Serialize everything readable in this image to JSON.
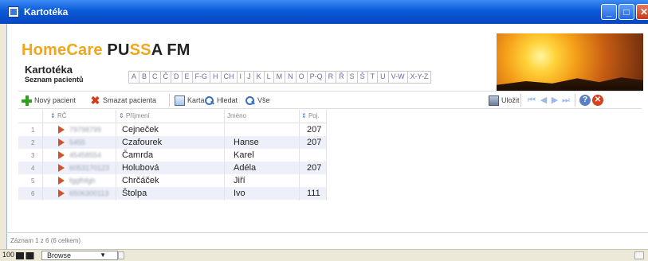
{
  "window": {
    "title": "Kartotéka"
  },
  "header": {
    "brand_part1": "HomeCare ",
    "brand_part2": "PU",
    "brand_part3": "SS",
    "brand_part4": "A FM",
    "section_title": "Kartotéka",
    "section_subtitle": "Seznam pacientů"
  },
  "alphabet": [
    "A",
    "B",
    "C",
    "Č",
    "D",
    "E",
    "F-G",
    "H",
    "CH",
    "I",
    "J",
    "K",
    "L",
    "M",
    "N",
    "O",
    "P-Q",
    "R",
    "Ř",
    "S",
    "Š",
    "T",
    "U",
    "V-W",
    "X-Y-Z"
  ],
  "toolbar": {
    "new_patient": "Nový pacient",
    "delete_patient": "Smazat pacienta",
    "card": "Karta",
    "search": "Hledat",
    "all": "Vše",
    "save": "Uložit"
  },
  "table": {
    "columns": {
      "rc": "RČ",
      "surname": "Příjmení",
      "name": "Jméno",
      "poj": "Poj."
    },
    "rows": [
      {
        "n": "1",
        "rc": "79798799",
        "surname": "Cejneček",
        "name": "",
        "poj": "207"
      },
      {
        "n": "2",
        "rc": "5455",
        "surname": "Czafourek",
        "name": "Hanse",
        "poj": "207"
      },
      {
        "n": "3",
        "rc": "45458554",
        "surname": "Čamrda",
        "name": "Karel",
        "poj": ""
      },
      {
        "n": "4",
        "rc": "6053170123",
        "surname": "Holubová",
        "name": "Adéla",
        "poj": "207"
      },
      {
        "n": "5",
        "rc": "fggfhfgh",
        "surname": "Chrčáček",
        "name": "Jiří",
        "poj": ""
      },
      {
        "n": "6",
        "rc": "6506300113",
        "surname": "Štolpa",
        "name": "Ivo",
        "poj": "111"
      }
    ]
  },
  "status": {
    "records": "Záznam 1 z 6 (6 celkem)",
    "zoom": "100",
    "mode": "Browse"
  },
  "colors": {
    "accent_orange": "#f2a51b",
    "title_bar_blue": "#0a5ad7",
    "row_alt": "#eef0f9"
  }
}
